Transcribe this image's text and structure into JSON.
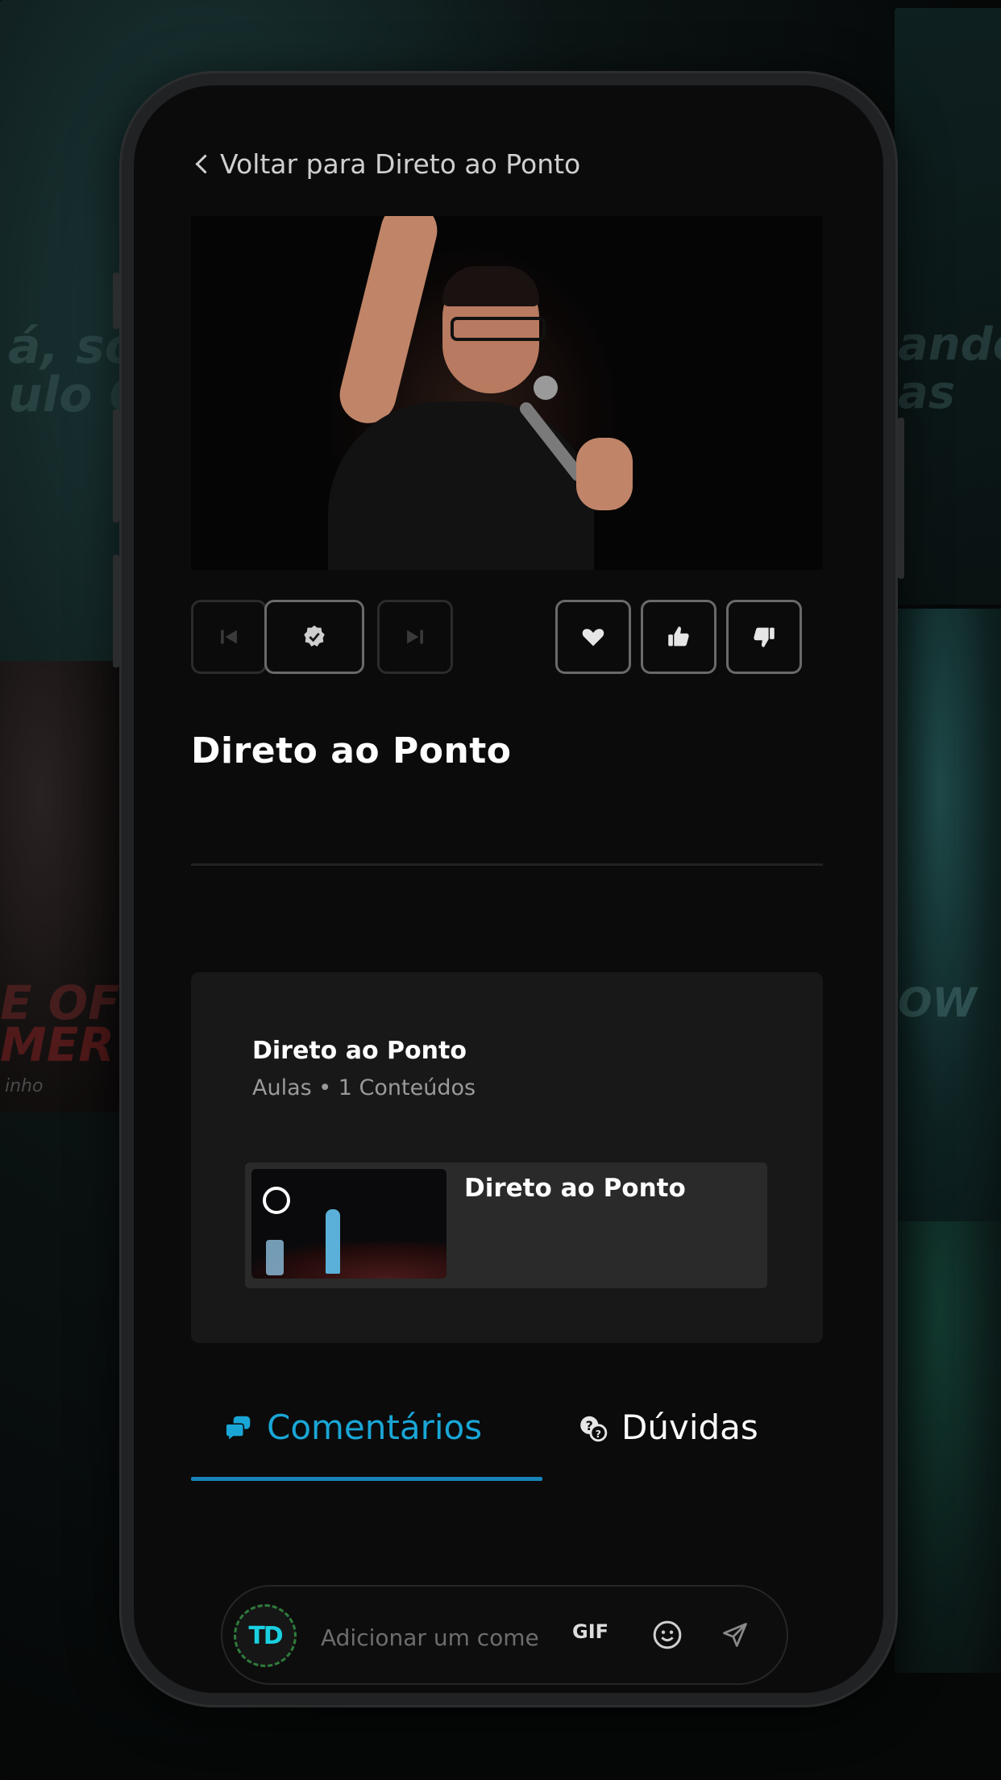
{
  "background": {
    "texts": [
      "á, sou",
      "ulo Co",
      "ando",
      "as",
      "E OF",
      "MER",
      "inho",
      "OW"
    ]
  },
  "header": {
    "back_label": "Voltar para Direto ao Ponto"
  },
  "controls": {
    "left": [
      "previous-icon",
      "check-badge-icon",
      "next-icon"
    ],
    "right": [
      "heart-icon",
      "thumbs-up-icon",
      "thumbs-down-icon"
    ]
  },
  "lesson": {
    "title": "Direto ao Ponto"
  },
  "module": {
    "title": "Direto ao Ponto",
    "meta": "Aulas • 1 Conteúdos",
    "items": [
      {
        "title": "Direto ao Ponto"
      }
    ]
  },
  "tabs": [
    {
      "label": "Comentários",
      "icon": "chat-bubbles-icon",
      "active": true
    },
    {
      "label": "Dúvidas",
      "icon": "question-bubbles-icon",
      "active": false
    }
  ],
  "composer": {
    "avatar_text": "TD",
    "placeholder": "Adicionar um comentário",
    "gif_label": "GIF"
  },
  "colors": {
    "accent": "#19a6d6",
    "underline": "#1684b8",
    "screen_bg": "#0b0b0b",
    "card_bg": "#181818"
  }
}
